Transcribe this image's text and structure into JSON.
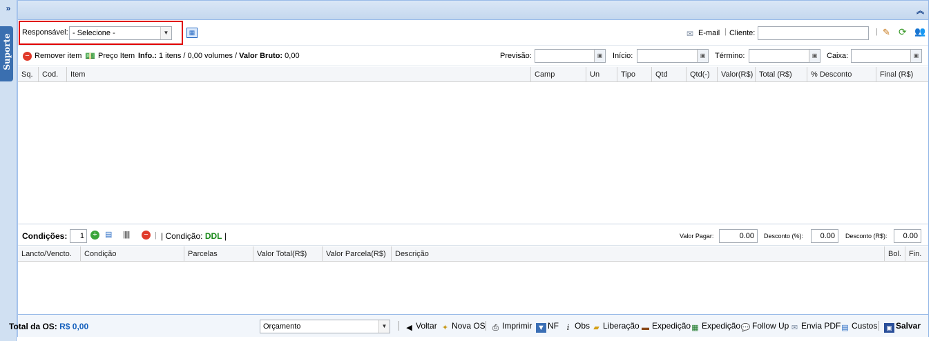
{
  "sidebar": {
    "expand_icon": "»",
    "tab_label": "Suporte"
  },
  "titlebar": {
    "collapse_icon": "⌃⌃"
  },
  "row1": {
    "responsavel_label": "Responsável:",
    "responsavel_value": "- Selecione -",
    "email_label": "E-mail",
    "cliente_label": "Cliente:",
    "cliente_value": ""
  },
  "row2": {
    "remover_label": "Remover item",
    "preco_label": "Preço Item",
    "info_label": "Info.:",
    "info_text": "1 itens / 0,00 volumes /",
    "valor_bruto_label": "Valor Bruto:",
    "valor_bruto_value": "0,00",
    "previsao_label": "Previsão:",
    "inicio_label": "Início:",
    "termino_label": "Término:",
    "caixa_label": "Caixa:"
  },
  "items_grid": {
    "columns": [
      "Sq.",
      "Cod.",
      "Item",
      "Camp",
      "Un",
      "Tipo",
      "Qtd",
      "Qtd(-)",
      "Valor(R$)",
      "Total (R$)",
      "% Desconto",
      "Final (R$)"
    ]
  },
  "conditions": {
    "label": "Condições:",
    "count": "1",
    "condicao_label": "| Condição:",
    "condicao_value": "DDL",
    "condicao_end": "|",
    "valor_pagar_label": "Valor Pagar:",
    "valor_pagar": "0.00",
    "desconto_pct_label": "Desconto (%):",
    "desconto_pct": "0.00",
    "desconto_rs_label": "Desconto (R$):",
    "desconto_rs": "0.00"
  },
  "payments_grid": {
    "columns": [
      "Lancto/Vencto.",
      "Condição",
      "Parcelas",
      "Valor Total(R$)",
      "Valor Parcela(R$)",
      "Descrição",
      "Bol.",
      "Fin."
    ]
  },
  "footer": {
    "total_label": "Total da OS:",
    "total_value": "R$ 0,00",
    "status_value": "Orçamento",
    "buttons": {
      "voltar": "Voltar",
      "nova_os": "Nova OS",
      "imprimir": "Imprimir",
      "nf": "NF",
      "obs": "Obs",
      "liberacao": "Liberação",
      "expedicao1": "Expedição",
      "expedicao2": "Expedição",
      "follow_up": "Follow Up",
      "envia_pdf": "Envia PDF",
      "custos": "Custos",
      "salvar": "Salvar"
    }
  },
  "colors": {
    "accent_blue": "#15428b",
    "green_value": "#1a8a1a",
    "total_blue": "#1560bd",
    "highlight_red": "#e00000"
  }
}
